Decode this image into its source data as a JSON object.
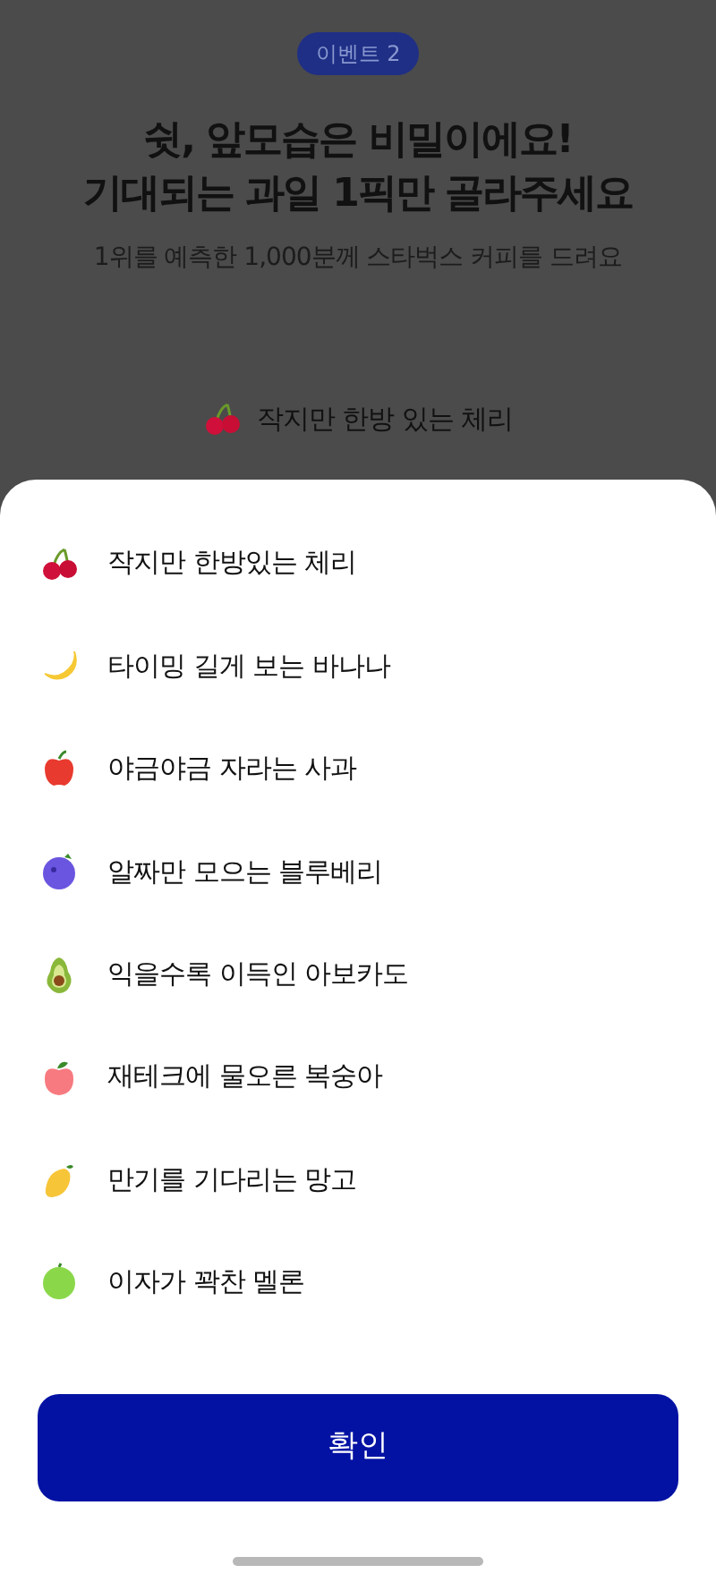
{
  "event_badge": "이벤트 2",
  "title_lines": [
    "쉿, 앞모습은 비밀이에요!",
    "기대되는 과일 1픽만 골라주세요"
  ],
  "subtitle": "1위를 예측한 1,000분께 스타벅스 커피를 드려요",
  "current_pick": {
    "kind": "cherry",
    "label": "작지만 한방 있는 체리"
  },
  "options": [
    {
      "kind": "cherry",
      "label": "작지만 한방있는 체리"
    },
    {
      "kind": "banana",
      "label": "타이밍 길게 보는 바나나"
    },
    {
      "kind": "apple",
      "label": "야금야금 자라는 사과"
    },
    {
      "kind": "blueberry",
      "label": "알짜만 모으는 블루베리"
    },
    {
      "kind": "avocado",
      "label": "익을수록 이득인 아보카도"
    },
    {
      "kind": "peach",
      "label": "재테크에 물오른 복숭아"
    },
    {
      "kind": "mango",
      "label": "만기를 기다리는 망고"
    },
    {
      "kind": "melon",
      "label": "이자가 꽉찬 멜론"
    }
  ],
  "confirm_button": "확인"
}
